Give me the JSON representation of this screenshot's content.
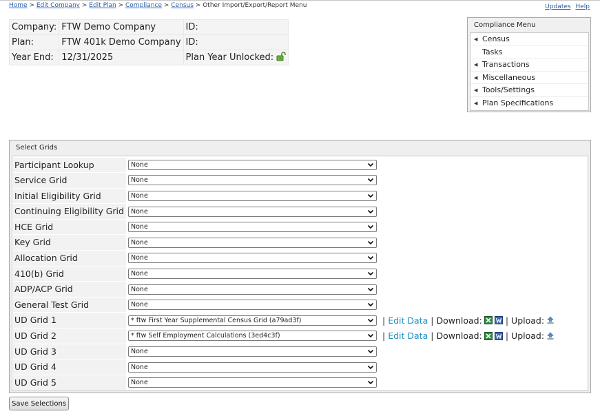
{
  "breadcrumb": {
    "links": [
      "Home",
      "Edit Company",
      "Edit Plan",
      "Compliance",
      "Census"
    ],
    "separator": ">",
    "current": "Other Import/Export/Report Menu"
  },
  "toplinks": {
    "updates": "Updates",
    "help": "Help"
  },
  "info": {
    "company_label": "Company:",
    "company_value": "FTW Demo Company",
    "company_id_label": "ID:",
    "plan_label": "Plan:",
    "plan_value": "FTW 401k Demo Company",
    "plan_id_label": "ID:",
    "year_end_label": "Year End:",
    "year_end_value": "12/31/2025",
    "plan_year_label": "Plan Year Unlocked:"
  },
  "compliance_menu": {
    "title": "Compliance Menu",
    "items": [
      {
        "label": "Census",
        "has_arrow": true
      },
      {
        "label": "Tasks",
        "has_arrow": false
      },
      {
        "label": "Transactions",
        "has_arrow": true
      },
      {
        "label": "Miscellaneous",
        "has_arrow": true
      },
      {
        "label": "Tools/Settings",
        "has_arrow": true
      },
      {
        "label": "Plan Specifications",
        "has_arrow": true
      }
    ]
  },
  "grids": {
    "title": "Select Grids",
    "rows": [
      {
        "name": "Participant Lookup",
        "value": "None"
      },
      {
        "name": "Service Grid",
        "value": "None"
      },
      {
        "name": "Initial Eligibility Grid",
        "value": "None"
      },
      {
        "name": "Continuing Eligibility Grid",
        "value": "None"
      },
      {
        "name": "HCE Grid",
        "value": "None"
      },
      {
        "name": "Key Grid",
        "value": "None"
      },
      {
        "name": "Allocation Grid",
        "value": "None"
      },
      {
        "name": "410(b) Grid",
        "value": "None"
      },
      {
        "name": "ADP/ACP Grid",
        "value": "None"
      },
      {
        "name": "General Test Grid",
        "value": "None"
      },
      {
        "name": "UD Grid 1",
        "value": "* ftw First Year Supplemental Census Grid (a79ad3f)",
        "edit_label": "Edit Data",
        "download_label": "Download:",
        "upload_label": "Upload:"
      },
      {
        "name": "UD Grid 2",
        "value": "* ftw Self Employment Calculations (3ed4c3f)",
        "edit_label": "Edit Data",
        "download_label": "Download:",
        "upload_label": "Upload:"
      },
      {
        "name": "UD Grid 3",
        "value": "None"
      },
      {
        "name": "UD Grid 4",
        "value": "None"
      },
      {
        "name": "UD Grid 5",
        "value": "None"
      }
    ]
  },
  "save_button": "Save Selections",
  "colors": {
    "link": "#2a5ea8",
    "edit_link": "#1e8fbf",
    "lock_green": "#5aa02c"
  },
  "icons": {
    "lock": "unlocked-padlock-icon",
    "excel": "excel-icon",
    "word": "word-icon",
    "upload": "upload-icon",
    "menu_arrow": "triangle-left-icon"
  }
}
